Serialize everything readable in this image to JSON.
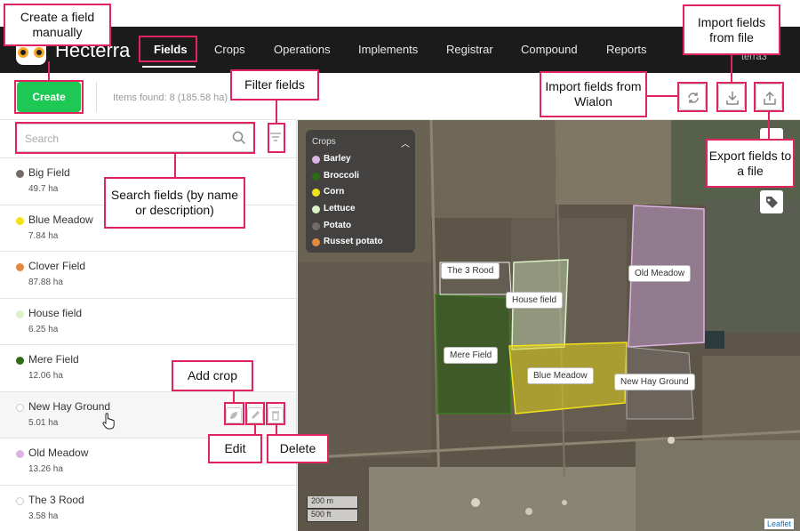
{
  "app": {
    "brand": "Hecterra",
    "user": "terra3"
  },
  "nav": [
    "Fields",
    "Crops",
    "Operations",
    "Implements",
    "Registrar",
    "Compound",
    "Reports"
  ],
  "toolbar": {
    "create_label": "Create",
    "items_found": "Items found: 8 (185.58 ha)"
  },
  "search": {
    "placeholder": "Search"
  },
  "fields": [
    {
      "name": "Big Field",
      "area": "49.7 ha",
      "color": "#756a6a"
    },
    {
      "name": "Blue Meadow",
      "area": "7.84 ha",
      "color": "#f2e21a"
    },
    {
      "name": "Clover Field",
      "area": "87.88 ha",
      "color": "#e48a3c"
    },
    {
      "name": "House field",
      "area": "6.25 ha",
      "color": "#dbf1c6"
    },
    {
      "name": "Mere Field",
      "area": "12.06 ha",
      "color": "#2f6a17"
    },
    {
      "name": "New Hay Ground",
      "area": "5.01 ha",
      "color": "#ffffff"
    },
    {
      "name": "Old Meadow",
      "area": "13.26 ha",
      "color": "#dcb3e3"
    },
    {
      "name": "The 3 Rood",
      "area": "3.58 ha",
      "color": "#ffffff"
    }
  ],
  "legend": {
    "title": "Crops",
    "items": [
      {
        "label": "Barley",
        "color": "#dcb3e3"
      },
      {
        "label": "Broccoli",
        "color": "#2f6a17"
      },
      {
        "label": "Corn",
        "color": "#f2e21a"
      },
      {
        "label": "Lettuce",
        "color": "#dbf1c6"
      },
      {
        "label": "Potato",
        "color": "#756a6a"
      },
      {
        "label": "Russet potato",
        "color": "#e48a3c"
      }
    ]
  },
  "map_labels": [
    "The 3 Rood",
    "House field",
    "Old Meadow",
    "Mere Field",
    "Blue Meadow",
    "New Hay Ground"
  ],
  "scale": {
    "metric": "200 m",
    "imperial": "500 ft"
  },
  "attribution": "Leaflet",
  "callouts": {
    "create": "Create a field manually",
    "filter": "Filter fields",
    "import_wialon": "Import fields from Wialon",
    "import_file": "Import fields from file",
    "export": "Export fields to a file",
    "search": "Search fields (by name or description)",
    "add_crop": "Add crop",
    "edit": "Edit",
    "delete": "Delete"
  }
}
